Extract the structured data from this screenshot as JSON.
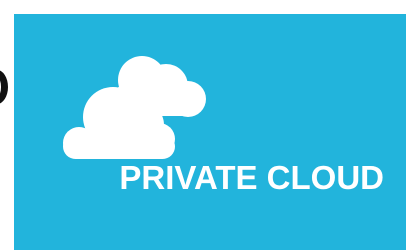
{
  "colors": {
    "tile_background": "#22b4dc",
    "cloud": "#ffffff",
    "label": "#ffffff",
    "page_background": "#ffffff",
    "edge_glyph": "#111111"
  },
  "tile": {
    "icon": "cloud-icon",
    "label": "PRIVATE CLOUD"
  }
}
